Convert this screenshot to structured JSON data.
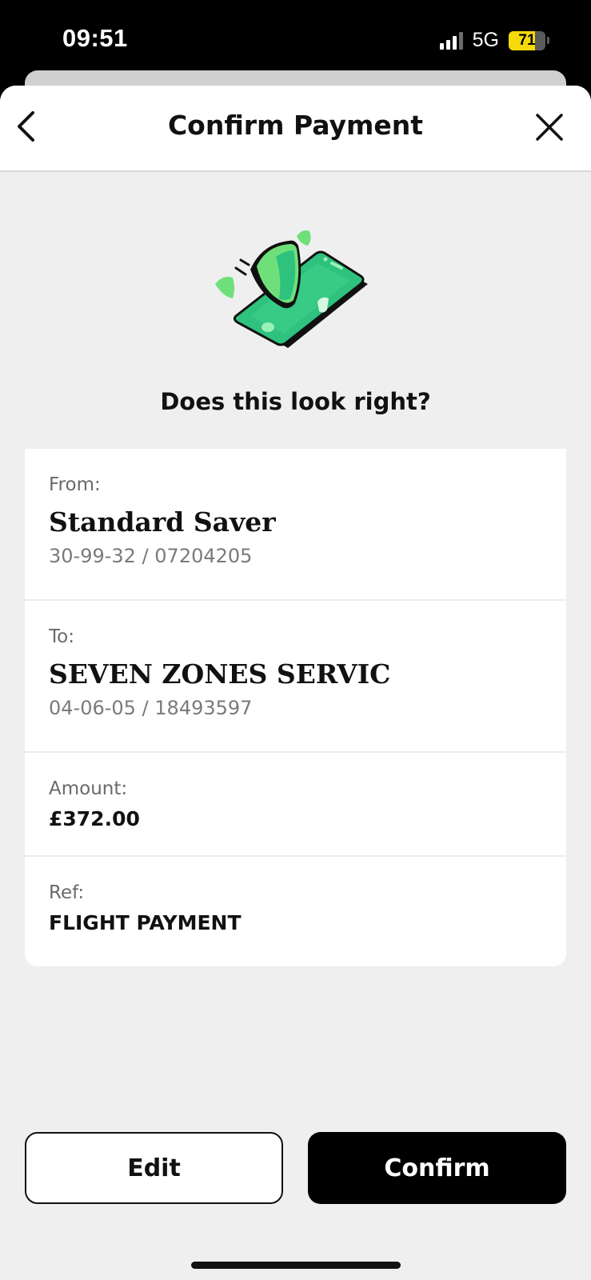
{
  "status_bar": {
    "time": "09:51",
    "network": "5G",
    "battery_level": "71",
    "battery_fraction": 0.71,
    "battery_color": "#f5d90a"
  },
  "header": {
    "title": "Confirm Payment",
    "back_icon": "chevron-left-icon",
    "close_icon": "close-icon"
  },
  "illustration_icon": "secure-phone-shield-icon",
  "question": "Does this look right?",
  "details": {
    "from": {
      "label": "From:",
      "name": "Standard Saver",
      "account": "30-99-32 / 07204205"
    },
    "to": {
      "label": "To:",
      "name": "SEVEN ZONES SERVIC",
      "account": "04-06-05 / 18493597"
    },
    "amount": {
      "label": "Amount:",
      "value": "£372.00"
    },
    "ref": {
      "label": "Ref:",
      "value": "FLIGHT PAYMENT"
    }
  },
  "actions": {
    "edit_label": "Edit",
    "confirm_label": "Confirm"
  },
  "colors": {
    "accent_green": "#2ec27e",
    "light_green": "#6ee07a",
    "background": "#efefef"
  }
}
